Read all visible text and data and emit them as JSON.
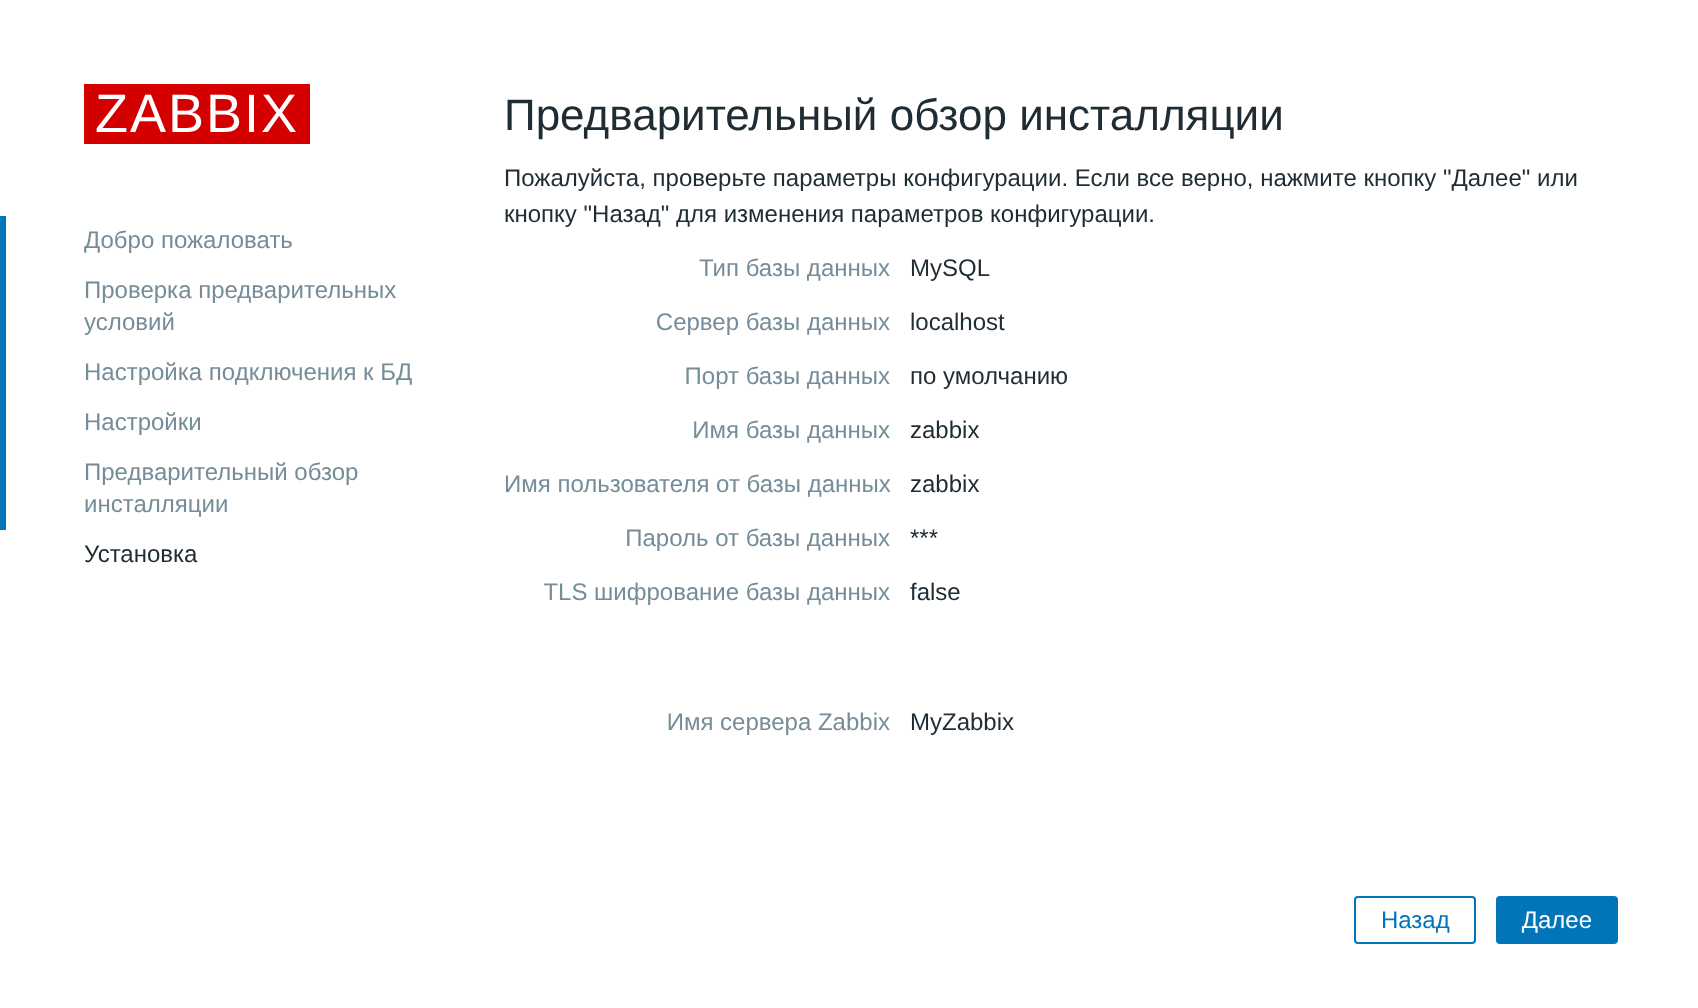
{
  "logo": "ZABBIX",
  "steps": [
    {
      "label": "Добро пожаловать",
      "completed": true
    },
    {
      "label": "Проверка предварительных условий",
      "completed": true
    },
    {
      "label": "Настройка подключения к БД",
      "completed": true
    },
    {
      "label": "Настройки",
      "completed": true
    },
    {
      "label": "Предварительный обзор инсталляции",
      "completed": true
    },
    {
      "label": "Установка",
      "completed": false
    }
  ],
  "title": "Предварительный обзор инсталляции",
  "description": "Пожалуйста, проверьте параметры конфигурации. Если все верно, нажмите кнопку \"Далее\" или кнопку \"Назад\" для изменения параметров конфигурации.",
  "database_settings": [
    {
      "label": "Тип базы данных",
      "value": "MySQL"
    },
    {
      "label": "Сервер базы данных",
      "value": "localhost"
    },
    {
      "label": "Порт базы данных",
      "value": "по умолчанию"
    },
    {
      "label": "Имя базы данных",
      "value": "zabbix"
    },
    {
      "label": "Имя пользователя от базы данных",
      "value": "zabbix"
    },
    {
      "label": "Пароль от базы данных",
      "value": "***"
    },
    {
      "label": "TLS шифрование базы данных",
      "value": "false"
    }
  ],
  "server_settings": [
    {
      "label": "Имя сервера Zabbix",
      "value": "MyZabbix"
    }
  ],
  "buttons": [
    {
      "label": "Назад",
      "kind": "secondary"
    },
    {
      "label": "Далее",
      "kind": "primary"
    }
  ]
}
